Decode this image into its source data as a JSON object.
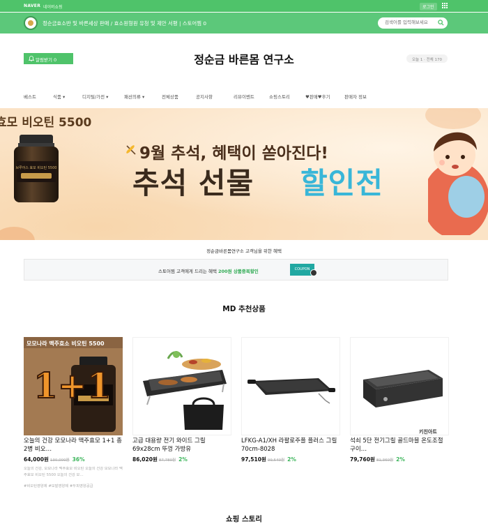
{
  "topbar": {
    "brand": "NAVER",
    "brand_sub": "네이버쇼핑",
    "login": "로그인"
  },
  "store_bar": {
    "description": "정순금효소반 및 바른세상 판매 / 효소원형원 유청 및 제안 서평  |  스토어찜 0",
    "search_placeholder": "검색어를 입력해보세요"
  },
  "header": {
    "follow_label": "알림받기 0",
    "title": "정순금 바른몸 연구소",
    "visitors": "오늘 1 · 전체 170"
  },
  "nav": {
    "items": [
      "베스트",
      "식품 ▾",
      "디지털/가전 ▾",
      "패션의류 ▾",
      "전체상품",
      "공지사항",
      "리뷰이벤트",
      "쇼핑스토리",
      "♥판매♥후기",
      "판매자 정보"
    ]
  },
  "banner": {
    "product_name": "효모 비오틴 5500",
    "headline": "9월 추석, 혜택이 쏟아진다!",
    "big_text_1": "추석 선물 ",
    "big_text_2": "할인전",
    "jar_label": "브루어스 효모 비오틴 5500"
  },
  "intro_text": "정순금바른몸연구소 고객님을 위한 혜택",
  "coupon": {
    "text_before": "스토어찜 고객에게 드리는 혜택 ",
    "highlight": "200원 상품중복할인",
    "button": "COUPON"
  },
  "md_section_title": "MD 추천상품",
  "products": [
    {
      "name": "오늘의 건강 모모나라 맥주효모 1+1 총2병 비오…",
      "price": "64,000원",
      "original": "130,000원",
      "discount": "36%",
      "summary": "오늘의 건강, 모모나라 맥주효모 비오틴 오늘의 건강 모모나라 맥주효모 비오틴 5500 오늘의 건강 모…",
      "tags": "#비오틴영양제 #모발영양제 #두피영양공급",
      "thumb_title": "모모나라 맥주효소 비오틴 5500",
      "thumb_badge": "1+1"
    },
    {
      "name": "고급 대용량 전기 와이드 그릴 69x28cm 뚜껑 가방유",
      "price": "86,020원",
      "original": "87,780원",
      "discount": "2%"
    },
    {
      "name": "LFKG-A1/XH 라팔로주플 플러스 그릴70cm-8028",
      "price": "97,510원",
      "original": "99,540원",
      "discount": "2%"
    },
    {
      "name": "석쇠 5단 전기그릴 골드마블 온도조절 구이…",
      "price": "79,760원",
      "original": "81,360원",
      "discount": "2%",
      "thumb_brand": "키친아트"
    }
  ],
  "story_section_title": "쇼핑 스토리",
  "colors": {
    "brand_green": "#4fc36a",
    "discount_green": "#3cb55b",
    "accent_blue": "#39b6d8",
    "coupon_teal": "#21a8a2"
  }
}
